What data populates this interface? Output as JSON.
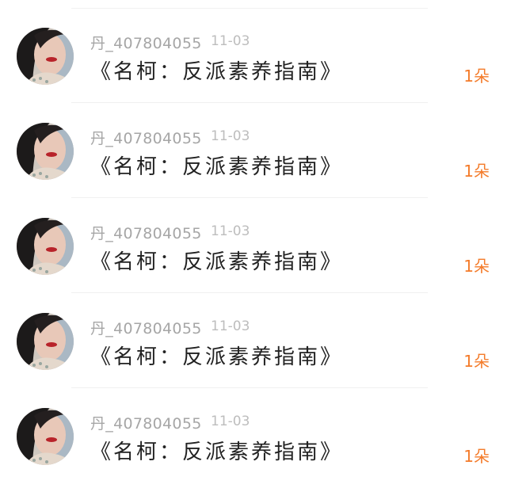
{
  "accent_color": "#f47b2a",
  "rows": [
    {
      "username": "丹_407804055",
      "date": "11-03",
      "book_title": "《名柯：反派素养指南》",
      "gift_count": "1朵"
    },
    {
      "username": "丹_407804055",
      "date": "11-03",
      "book_title": "《名柯：反派素养指南》",
      "gift_count": "1朵"
    },
    {
      "username": "丹_407804055",
      "date": "11-03",
      "book_title": "《名柯：反派素养指南》",
      "gift_count": "1朵"
    },
    {
      "username": "丹_407804055",
      "date": "11-03",
      "book_title": "《名柯：反派素养指南》",
      "gift_count": "1朵"
    },
    {
      "username": "丹_407804055",
      "date": "11-03",
      "book_title": "《名柯：反派素养指南》",
      "gift_count": "1朵"
    }
  ]
}
